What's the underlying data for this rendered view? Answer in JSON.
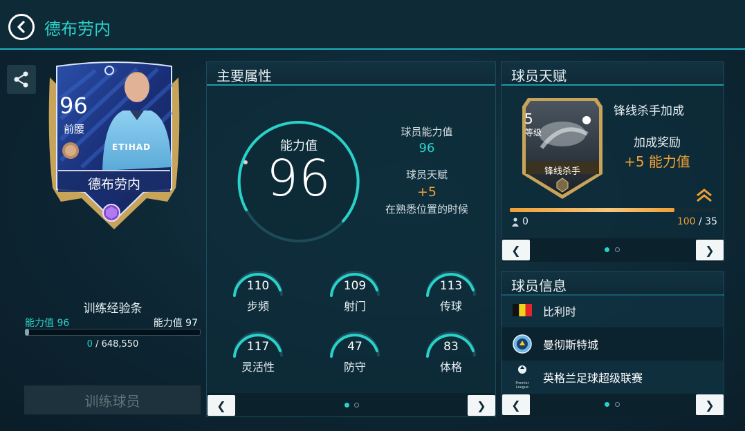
{
  "header": {
    "title": "德布劳内"
  },
  "card": {
    "rating": "96",
    "position": "前腰",
    "name": "德布劳内",
    "sponsor": "ETIHAD"
  },
  "training": {
    "title": "训练经验条",
    "from_label": "能力值",
    "from_value": "96",
    "to_label": "能力值",
    "to_value": "97",
    "current": "0",
    "total": "/ 648,550",
    "progress": 0,
    "button_label": "训练球员"
  },
  "attributes": {
    "title": "主要属性",
    "ovr_label": "能力值",
    "ovr_value": "96",
    "player_rating_label": "球员能力值",
    "player_rating_value": "96",
    "talent_label": "球员天赋",
    "talent_value": "+5",
    "talent_note": "在熟悉位置的时候",
    "stats": [
      {
        "label": "步频",
        "value": "110"
      },
      {
        "label": "射门",
        "value": "109"
      },
      {
        "label": "传球",
        "value": "113"
      },
      {
        "label": "灵活性",
        "value": "117"
      },
      {
        "label": "防守",
        "value": "47"
      },
      {
        "label": "体格",
        "value": "83"
      }
    ],
    "pager": {
      "pages": 2,
      "current": 1
    }
  },
  "talent": {
    "title": "球员天赋",
    "level": "5",
    "level_label": "等级",
    "badge_label": "锋线杀手",
    "name": "锋线杀手加成",
    "bonus_label": "加成奖励",
    "bonus_value": "+5 能力值",
    "progress": 0.8,
    "left_count": "0",
    "right_current": "100",
    "right_total": "/ 35",
    "pager": {
      "pages": 2,
      "current": 1
    }
  },
  "info": {
    "title": "球员信息",
    "rows": [
      {
        "icon": "belgium-flag-icon",
        "text": "比利时"
      },
      {
        "icon": "man-city-crest-icon",
        "text": "曼彻斯特城"
      },
      {
        "icon": "premier-league-logo-icon",
        "text": "英格兰足球超级联赛",
        "logo_text": "Premier League"
      }
    ],
    "pager": {
      "pages": 2,
      "current": 1
    }
  },
  "colors": {
    "teal": "#29d2c8",
    "orange": "#f0a035",
    "panel": "#0e2c3a"
  }
}
